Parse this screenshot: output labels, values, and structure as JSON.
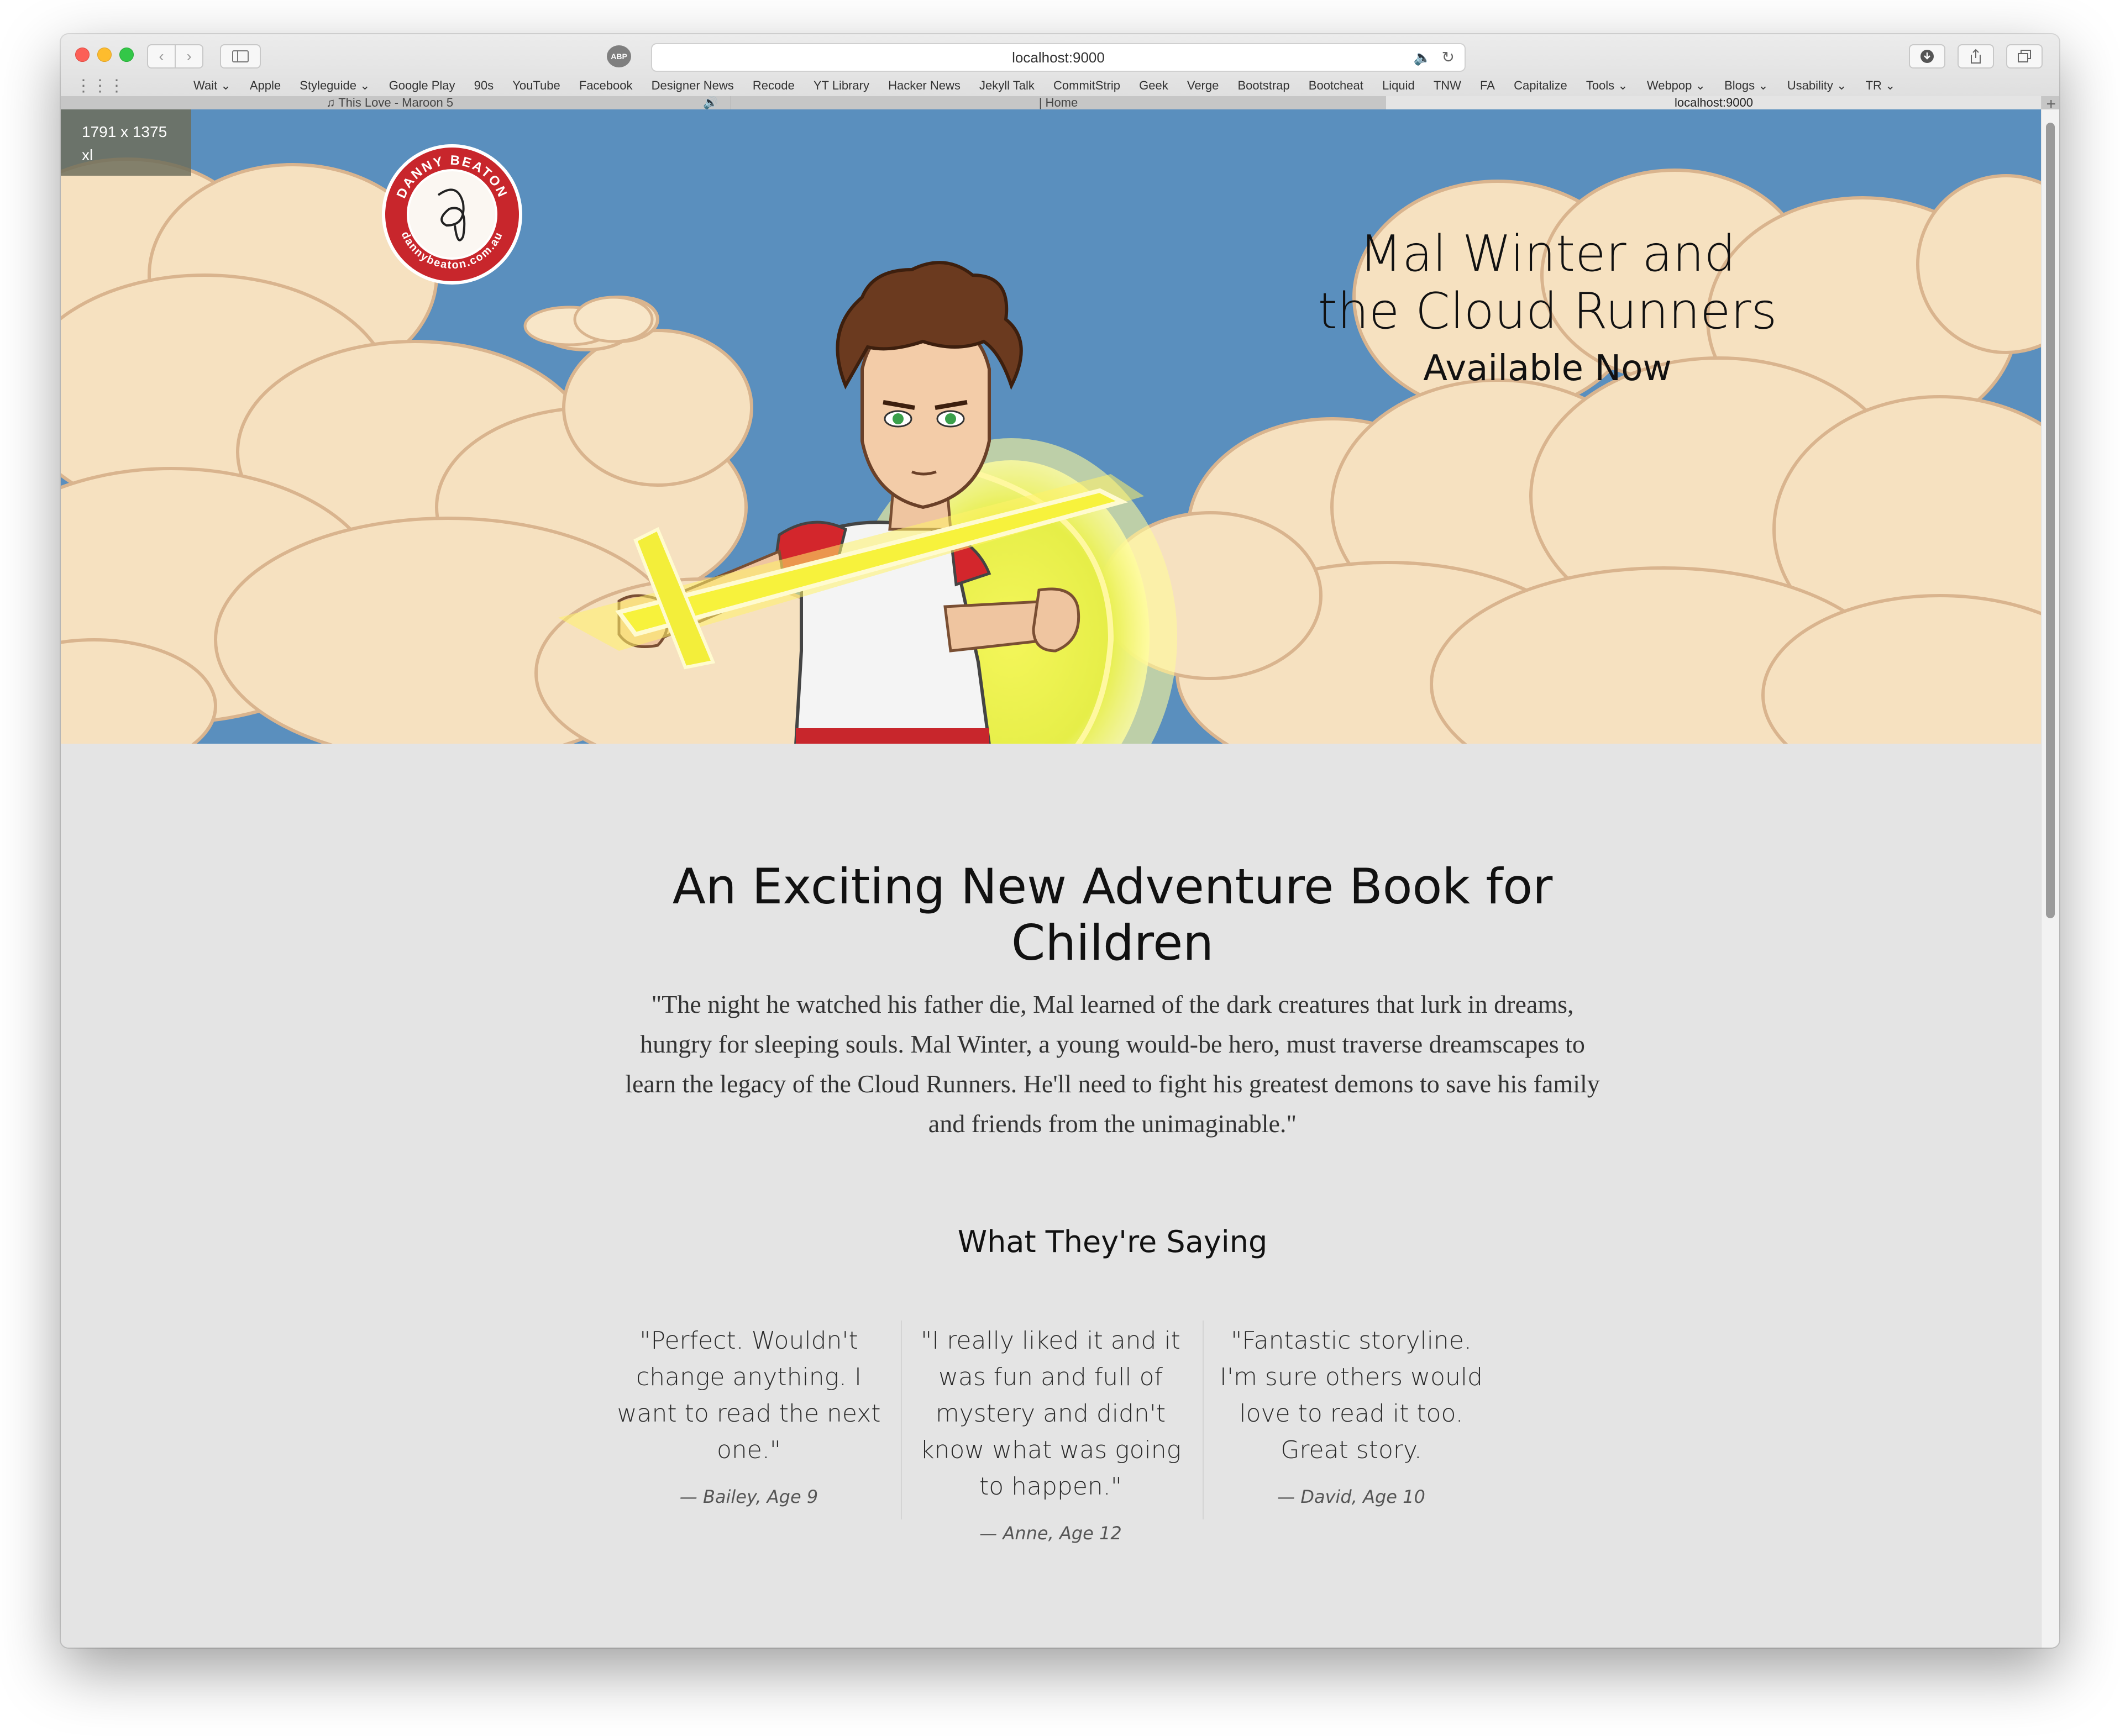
{
  "browser": {
    "address": "localhost:9000",
    "abp_label": "ABP",
    "bookmarks": [
      "Wait ⌄",
      "Apple",
      "Styleguide ⌄",
      "Google Play",
      "90s",
      "YouTube",
      "Facebook",
      "Designer News",
      "Recode",
      "YT Library",
      "Hacker News",
      "Jekyll Talk",
      "CommitStrip",
      "Geek",
      "Verge",
      "Bootstrap",
      "Bootcheat",
      "Liquid",
      "TNW",
      "FA",
      "Capitalize",
      "Tools ⌄",
      "Webpop ⌄",
      "Blogs ⌄",
      "Usability ⌄",
      "TR ⌄"
    ],
    "tabs": [
      "♫ This Love - Maroon 5",
      "| Home",
      "localhost:9000"
    ]
  },
  "breakpoint": {
    "size": "1791 x 1375",
    "label": "xl"
  },
  "logo": {
    "top_text": "DANNY BEATON",
    "bottom_text": "dannybeaton.com.au"
  },
  "hero": {
    "title_line1": "Mal Winter and",
    "title_line2": "the Cloud Runners",
    "subtitle": "Available Now"
  },
  "intro": {
    "heading_line1": "An Exciting New Adventure Book for",
    "heading_line2": "Children",
    "text": "\"The night he watched his father die, Mal learned of the dark creatures that lurk in dreams, hungry for sleeping souls. Mal Winter, a young would-be hero, must traverse dreamscapes to learn the legacy of the Cloud Runners. He'll need to fight his greatest demons to save his family and friends from the unimaginable.\""
  },
  "testimonials": {
    "heading": "What They're Saying",
    "items": [
      {
        "quote": "\"Perfect. Wouldn't change anything. I want to read the next one.\"",
        "author": "— Bailey, Age 9"
      },
      {
        "quote": "\"I really liked it and it was fun and full of mystery and didn't know what was going to happen.\"",
        "author": "— Anne, Age 12"
      },
      {
        "quote": "\"Fantastic storyline. I'm sure others would love to read it too. Great story.",
        "author": "— David, Age 10"
      }
    ]
  },
  "colors": {
    "sky": "#5a8fbe",
    "cloud": "#f6e1c0",
    "page_bg": "#e4e4e4",
    "logo_red": "#c8262c"
  }
}
